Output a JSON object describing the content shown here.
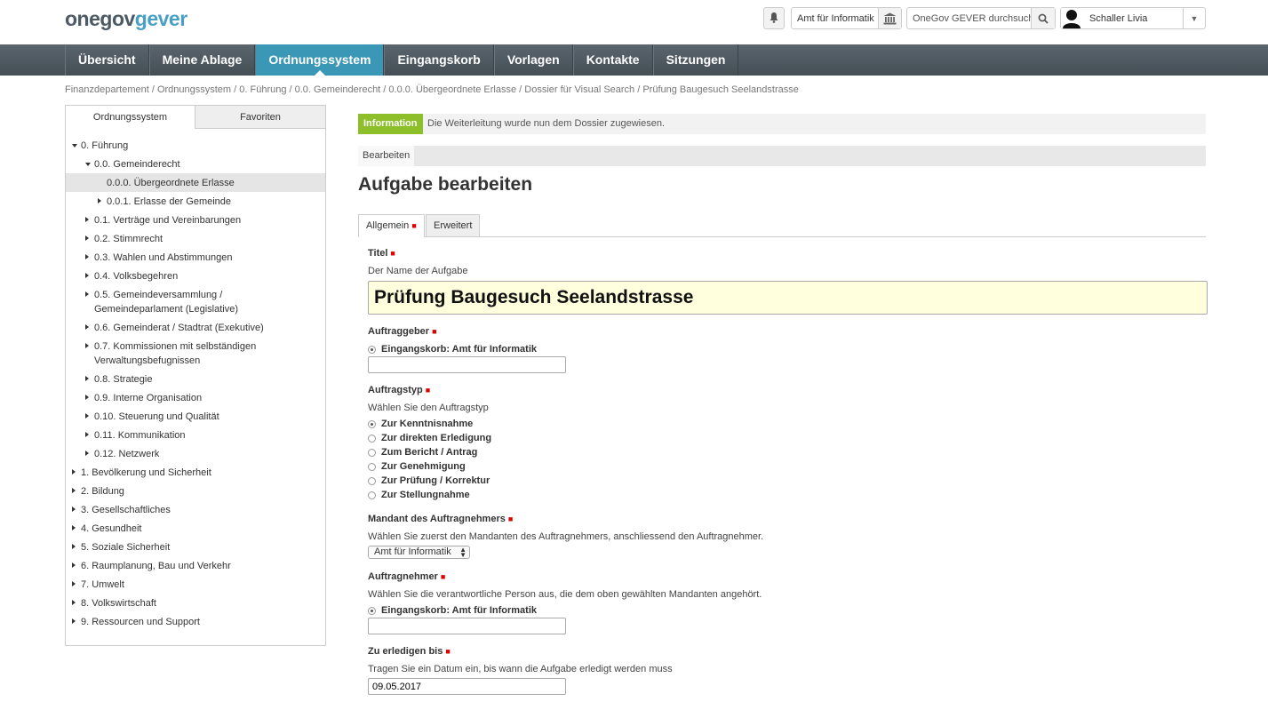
{
  "header": {
    "logo_part1": "onegov",
    "logo_part2": "gever",
    "org_selector": "Amt für Informatik",
    "search_placeholder": "OneGov GEVER durchsuchen",
    "user_name": "Schaller Livia"
  },
  "nav": {
    "items": [
      "Übersicht",
      "Meine Ablage",
      "Ordnungssystem",
      "Eingangskorb",
      "Vorlagen",
      "Kontakte",
      "Sitzungen"
    ],
    "active": "Ordnungssystem"
  },
  "breadcrumb": "Finanzdepartement / Ordnungssystem / 0. Führung / 0.0. Gemeinderecht / 0.0.0. Übergeordnete Erlasse / Dossier für Visual Search / Prüfung Baugesuch Seelandstrasse",
  "sidebar": {
    "tabs": [
      "Ordnungssystem",
      "Favoriten"
    ],
    "tree": [
      {
        "label": "0. Führung",
        "level": 0,
        "state": "open"
      },
      {
        "label": "0.0. Gemeinderecht",
        "level": 1,
        "state": "open"
      },
      {
        "label": "0.0.0. Übergeordnete Erlasse",
        "level": 2,
        "state": "leaf",
        "selected": true
      },
      {
        "label": "0.0.1. Erlasse der Gemeinde",
        "level": 2,
        "state": "closed"
      },
      {
        "label": "0.1. Verträge und Vereinbarungen",
        "level": 1,
        "state": "closed"
      },
      {
        "label": "0.2. Stimmrecht",
        "level": 1,
        "state": "closed"
      },
      {
        "label": "0.3. Wahlen und Abstimmungen",
        "level": 1,
        "state": "closed"
      },
      {
        "label": "0.4. Volksbegehren",
        "level": 1,
        "state": "closed"
      },
      {
        "label": "0.5. Gemeindeversammlung / Gemeindeparlament (Legislative)",
        "level": 1,
        "state": "closed",
        "lines": [
          "0.5. Gemeindeversammlung /",
          "Gemeindeparlament (Legislative)"
        ]
      },
      {
        "label": "0.6. Gemeinderat / Stadtrat (Exekutive)",
        "level": 1,
        "state": "closed"
      },
      {
        "label": "0.7. Kommissionen mit selbständigen Verwaltungsbefugnissen",
        "level": 1,
        "state": "closed",
        "lines": [
          "0.7. Kommissionen mit selbständigen",
          "Verwaltungsbefugnissen"
        ]
      },
      {
        "label": "0.8. Strategie",
        "level": 1,
        "state": "closed"
      },
      {
        "label": "0.9. Interne Organisation",
        "level": 1,
        "state": "closed"
      },
      {
        "label": "0.10. Steuerung und Qualität",
        "level": 1,
        "state": "closed"
      },
      {
        "label": "0.11. Kommunikation",
        "level": 1,
        "state": "closed"
      },
      {
        "label": "0.12. Netzwerk",
        "level": 1,
        "state": "closed"
      },
      {
        "label": "1. Bevölkerung und Sicherheit",
        "level": 0,
        "state": "closed"
      },
      {
        "label": "2. Bildung",
        "level": 0,
        "state": "closed"
      },
      {
        "label": "3. Gesellschaftliches",
        "level": 0,
        "state": "closed"
      },
      {
        "label": "4. Gesundheit",
        "level": 0,
        "state": "closed"
      },
      {
        "label": "5. Soziale Sicherheit",
        "level": 0,
        "state": "closed"
      },
      {
        "label": "6. Raumplanung, Bau und Verkehr",
        "level": 0,
        "state": "closed"
      },
      {
        "label": "7. Umwelt",
        "level": 0,
        "state": "closed"
      },
      {
        "label": "8. Volkswirtschaft",
        "level": 0,
        "state": "closed"
      },
      {
        "label": "9. Ressourcen und Support",
        "level": 0,
        "state": "closed"
      }
    ]
  },
  "info": {
    "badge": "Information",
    "message": "Die Weiterleitung wurde nun dem Dossier zugewiesen."
  },
  "edit_tab": "Bearbeiten",
  "page_title": "Aufgabe bearbeiten",
  "form_tabs": [
    "Allgemein",
    "Erweitert"
  ],
  "form": {
    "title_label": "Titel",
    "title_help": "Der Name der Aufgabe",
    "title_value": "Prüfung Baugesuch Seelandstrasse",
    "issuer_label": "Auftraggeber",
    "issuer_option": "Eingangskorb: Amt für Informatik",
    "issuer_input": "",
    "type_label": "Auftragstyp",
    "type_help": "Wählen Sie den Auftragstyp",
    "type_options": [
      "Zur Kenntnisnahme",
      "Zur direkten Erledigung",
      "Zum Bericht / Antrag",
      "Zur Genehmigung",
      "Zur Prüfung / Korrektur",
      "Zur Stellungnahme"
    ],
    "type_selected": "Zur Kenntnisnahme",
    "client_label": "Mandant des Auftragnehmers",
    "client_help": "Wählen Sie zuerst den Mandanten des Auftragnehmers, anschliessend den Auftragnehmer.",
    "client_value": "Amt für Informatik",
    "responsible_label": "Auftragnehmer",
    "responsible_help": "Wählen Sie die verantwortliche Person aus, die dem oben gewählten Mandanten angehört.",
    "responsible_option": "Eingangskorb: Amt für Informatik",
    "responsible_input": "",
    "deadline_label": "Zu erledigen bis",
    "deadline_help": "Tragen Sie ein Datum ein, bis wann die Aufgabe erledigt werden muss",
    "deadline_value": "09.05.2017"
  },
  "icons": {
    "bell": "bell-icon",
    "bank": "bank-icon",
    "search": "search-icon",
    "user": "avatar-icon",
    "dropdown": "chevron-down-icon"
  },
  "colors": {
    "nav_active": "#3a97b5",
    "info_badge": "#8dbf2a",
    "required": "#dd0000",
    "title_input_bg": "#ffffdd"
  }
}
